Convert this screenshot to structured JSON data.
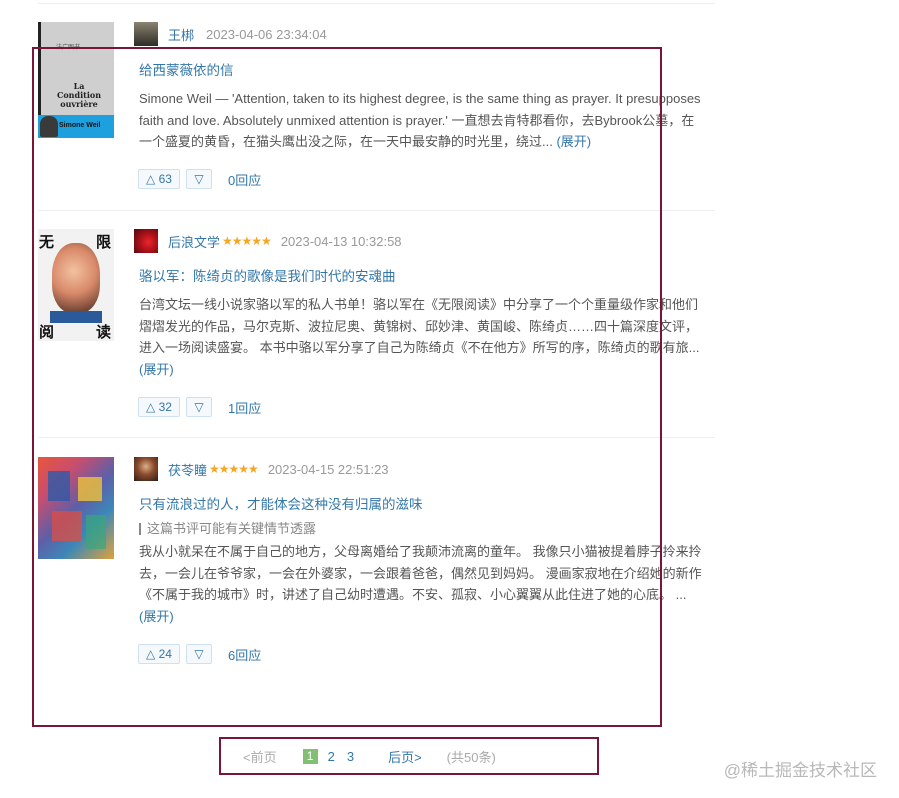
{
  "reviews": [
    {
      "book_cover": "La Condition ouvrière book cover",
      "cover_text": {
        "publisher": "法广图书",
        "title_line1": "La",
        "title_line2": "Condition",
        "title_line3": "ouvrière",
        "author": "Simone Weil"
      },
      "user": "王梆",
      "rating_stars": "",
      "time": "2023-04-06 23:34:04",
      "title": "给西蒙薇依的信",
      "spoiler": "",
      "excerpt": "Simone Weil — 'Attention, taken to its highest degree, is the same thing as prayer. It presupposes faith and love. Absolutely unmixed attention is prayer.' 一直想去肯特郡看你，去Bybrook公墓，在一个盛夏的黄昏，在猫头鹰出没之际，在一天中最安静的时光里，绕过...",
      "expand_label": "(展开)",
      "useful_count": "△ 63",
      "useless_label": "▽",
      "replies": "0回应"
    },
    {
      "book_cover": "无限阅读 book cover",
      "cover_text": {
        "c1": "无",
        "c2": "限",
        "c3": "阅",
        "c4": "读"
      },
      "user": "后浪文学",
      "rating_stars": "★★★★★",
      "time": "2023-04-13 10:32:58",
      "title": "骆以军：陈绮贞的歌像是我们时代的安魂曲",
      "spoiler": "",
      "excerpt": "台湾文坛一线小说家骆以军的私人书单！骆以军在《无限阅读》中分享了一个个重量级作家和他们熠熠发光的作品，马尔克斯、波拉尼奥、黄锦树、邱妙津、黄国峻、陈绮贞……四十篇深度文评，进入一场阅读盛宴。 本书中骆以军分享了自己为陈绮贞《不在他方》所写的序，陈绮贞的歌有旅...",
      "expand_label": "(展开)",
      "useful_count": "△ 32",
      "useless_label": "▽",
      "replies": "1回应"
    },
    {
      "book_cover": "不属于我的城市 book cover",
      "cover_text": {},
      "user": "茯苓瞳",
      "rating_stars": "★★★★★",
      "time": "2023-04-15 22:51:23",
      "title": "只有流浪过的人，才能体会这种没有归属的滋味",
      "spoiler": "这篇书评可能有关键情节透露",
      "excerpt": "我从小就呆在不属于自己的地方，父母离婚给了我颠沛流离的童年。 我像只小猫被提着脖子拎来拎去，一会儿在爷爷家，一会在外婆家，一会跟着爸爸，偶然见到妈妈。 漫画家寂地在介绍她的新作《不属于我的城市》时，讲述了自己幼时遭遇。不安、孤寂、小心翼翼从此住进了她的心底。 ...",
      "expand_label": "(展开)",
      "useful_count": "△ 24",
      "useless_label": "▽",
      "replies": "6回应"
    }
  ],
  "pagination": {
    "prev": "<前页",
    "pages": [
      "1",
      "2",
      "3"
    ],
    "current": "1",
    "next": "后页>",
    "total": "(共50条)"
  },
  "watermark": "@稀土掘金技术社区",
  "colors": {
    "link": "#3377aa",
    "star": "#f5a623",
    "frame": "#7a1535",
    "current_page": "#83bf73"
  }
}
